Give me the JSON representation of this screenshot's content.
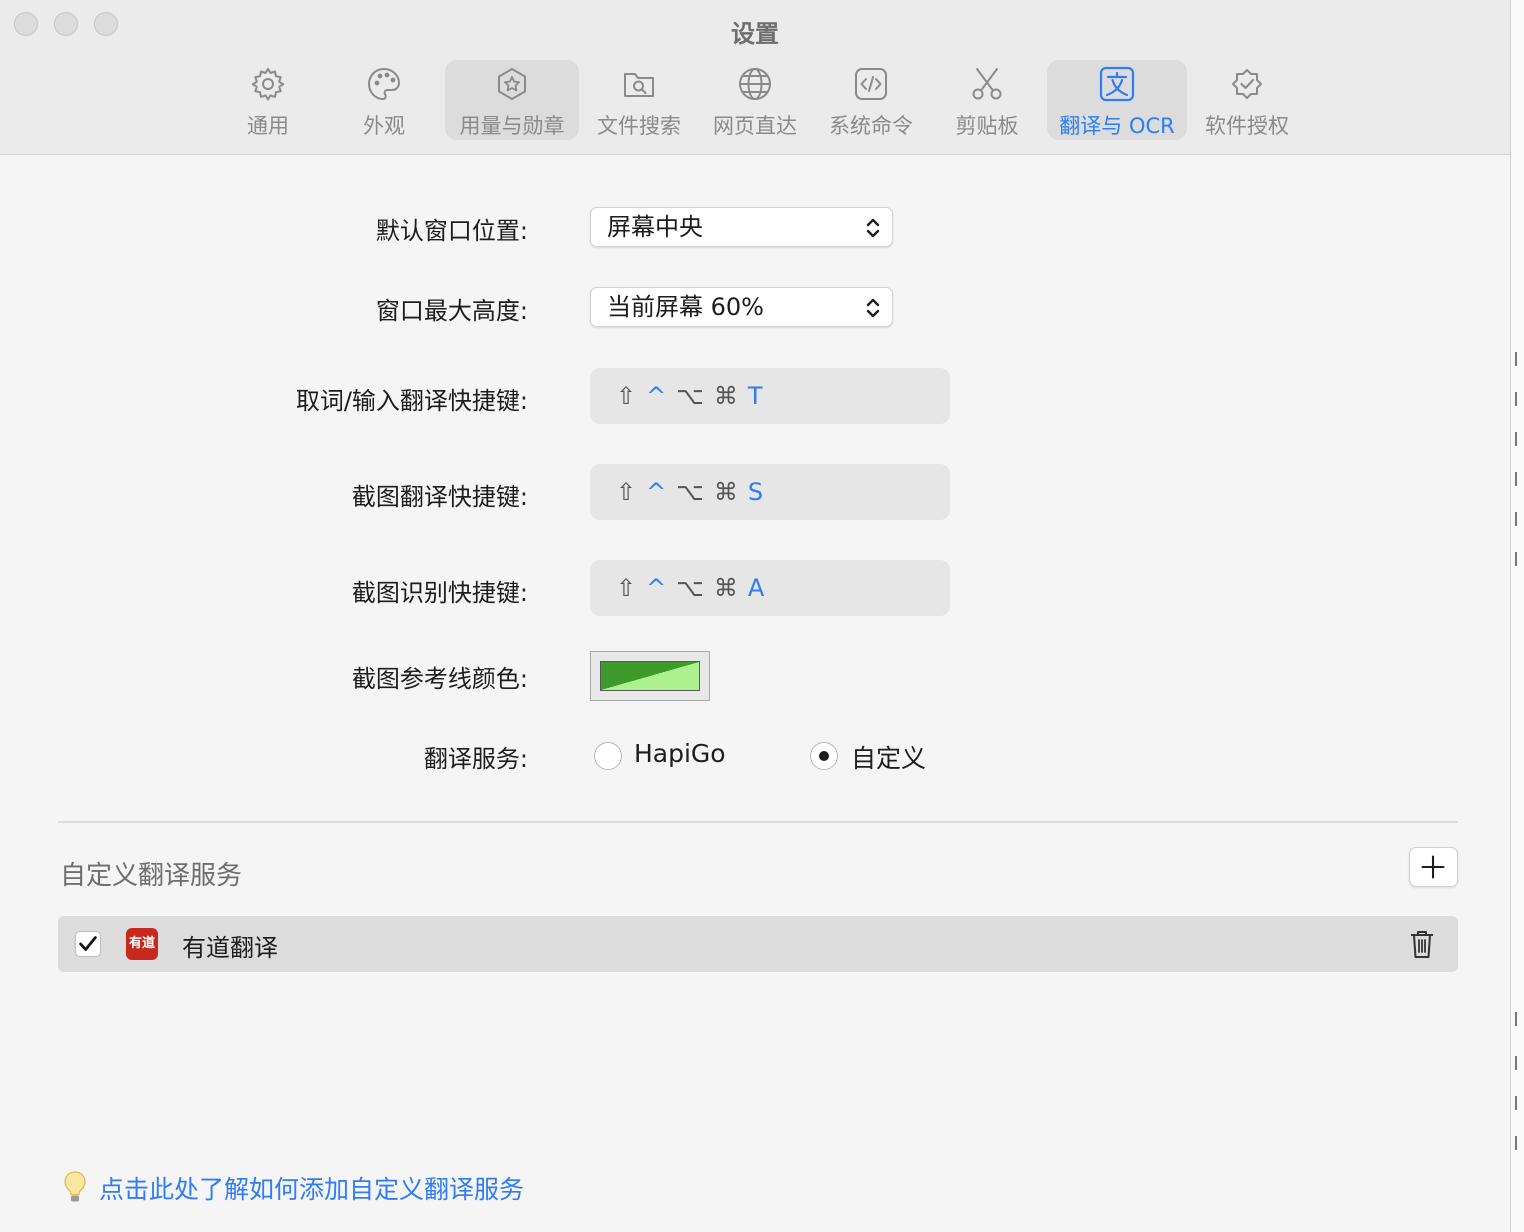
{
  "window": {
    "title": "设置"
  },
  "tabs": [
    {
      "label": "通用",
      "icon": "gear-icon"
    },
    {
      "label": "外观",
      "icon": "palette-icon"
    },
    {
      "label": "用量与勋章",
      "icon": "badge-star-icon"
    },
    {
      "label": "文件搜索",
      "icon": "folder-search-icon"
    },
    {
      "label": "网页直达",
      "icon": "globe-icon"
    },
    {
      "label": "系统命令",
      "icon": "code-icon"
    },
    {
      "label": "剪贴板",
      "icon": "scissors-icon"
    },
    {
      "label": "翻译与 OCR",
      "icon": "translate-icon",
      "active": true
    },
    {
      "label": "软件授权",
      "icon": "check-badge-icon"
    }
  ],
  "settings": {
    "window_position": {
      "label": "默认窗口位置:",
      "value": "屏幕中央"
    },
    "max_height": {
      "label": "窗口最大高度:",
      "value": "当前屏幕 60%"
    },
    "word_shortcut": {
      "label": "取词/输入翻译快捷键:",
      "key": "T"
    },
    "screenshot_translate_shortcut": {
      "label": "截图翻译快捷键:",
      "key": "S"
    },
    "screenshot_ocr_shortcut": {
      "label": "截图识别快捷键:",
      "key": "A"
    },
    "modifiers": [
      "⇧",
      "^",
      "⌥",
      "⌘"
    ],
    "guide_color": {
      "label": "截图参考线颜色:"
    },
    "translate_service": {
      "label": "翻译服务:",
      "options": [
        "HapiGo",
        "自定义"
      ],
      "selected": "自定义"
    }
  },
  "custom_services": {
    "title": "自定义翻译服务",
    "add_label": "+",
    "items": [
      {
        "name": "有道翻译",
        "checked": true,
        "logo_text": "有道"
      }
    ]
  },
  "help": {
    "text": "点击此处了解如何添加自定义翻译服务"
  },
  "colors": {
    "accent": "#2e7cf6",
    "guide_dark": "#3f9a2b",
    "guide_light": "#adf08e",
    "youdao_red": "#c8281e"
  }
}
